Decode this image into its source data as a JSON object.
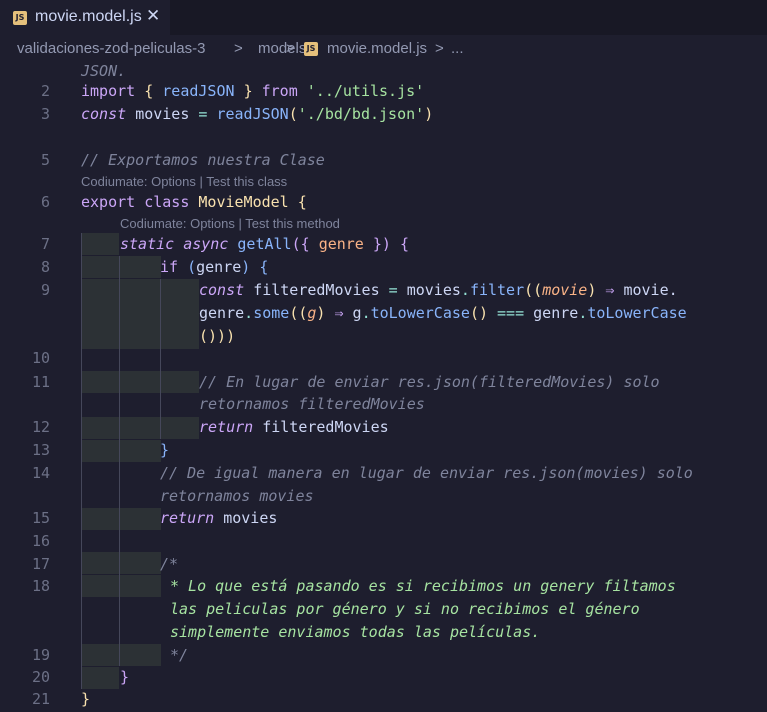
{
  "tab": {
    "file_icon": "JS",
    "title": "movie.model.js",
    "close_glyph": "✕"
  },
  "breadcrumb": {
    "folder": "validaciones-zod-peliculas-3",
    "sep1": ">",
    "subfolder": "models",
    "sep2": ">",
    "file_icon": "JS",
    "file": "movie.model.js",
    "sep3": ">",
    "more": "..."
  },
  "codelens": {
    "class_lens": "Codiumate: Options | Test this class",
    "method_lens": "Codiumate: Options | Test this method"
  },
  "code": {
    "l1_tail": "JSON.",
    "l2": {
      "import": "import",
      "brace_open": "{",
      "name": "readJSON",
      "brace_close": "}",
      "from": "from",
      "path": "'../utils.js'"
    },
    "l3": {
      "const": "const",
      "name": "movies",
      "eq": "=",
      "fn": "readJSON",
      "p_open": "(",
      "arg": "'./bd/bd.json'",
      "p_close": ")"
    },
    "l5": "// Exportamos nuestra Clase",
    "l6": {
      "export": "export",
      "class": "class",
      "name": "MovieModel",
      "brace": "{"
    },
    "l7": {
      "static": "static",
      "async": "async",
      "fn": "getAll",
      "open": "({",
      "param": "genre",
      "close": "})",
      "brace": "{"
    },
    "l8": {
      "if": "if",
      "open": "(",
      "var": "genre",
      "close": ")",
      "brace": "{"
    },
    "l9a": {
      "const": "const",
      "name": "filteredMovies",
      "eq": "=",
      "obj": "movies",
      "dot": ".",
      "fn": "filter",
      "open": "((",
      "param": "movie",
      "close": ")",
      "arrow": "⇒",
      "tail": "movie."
    },
    "l9b": {
      "obj": "genre",
      "dot": ".",
      "fn": "some",
      "open": "((",
      "param": "g",
      "close": ")",
      "arrow": "⇒",
      "g": "g",
      "dot2": ".",
      "fn2": "toLowerCase",
      "call": "()",
      "eqeq": "===",
      "obj2": "genre",
      "dot3": ".",
      "fn3": "toLowerCase"
    },
    "l9c": "()))",
    "l11a": "// En lugar de enviar res.json(filteredMovies) solo",
    "l11b": "retornamos filteredMovies",
    "l12": {
      "return": "return",
      "var": "filteredMovies"
    },
    "l13": "}",
    "l14a": "// De igual manera en lugar de enviar res.json(movies) solo",
    "l14b": "retornamos movies",
    "l15": {
      "return": "return",
      "var": "movies"
    },
    "l17": "/*",
    "l18a": "* Lo que está pasando es si recibimos un genery filtamos",
    "l18b": "las peliculas por género y si no recibimos el género",
    "l18c": "simplemente enviamos todas las películas.",
    "l19": "*/",
    "l20": "}",
    "l21": "}"
  },
  "line_numbers": [
    "2",
    "3",
    "5",
    "6",
    "7",
    "8",
    "9",
    "10",
    "11",
    "12",
    "13",
    "14",
    "15",
    "16",
    "17",
    "18",
    "19",
    "20",
    "21"
  ]
}
